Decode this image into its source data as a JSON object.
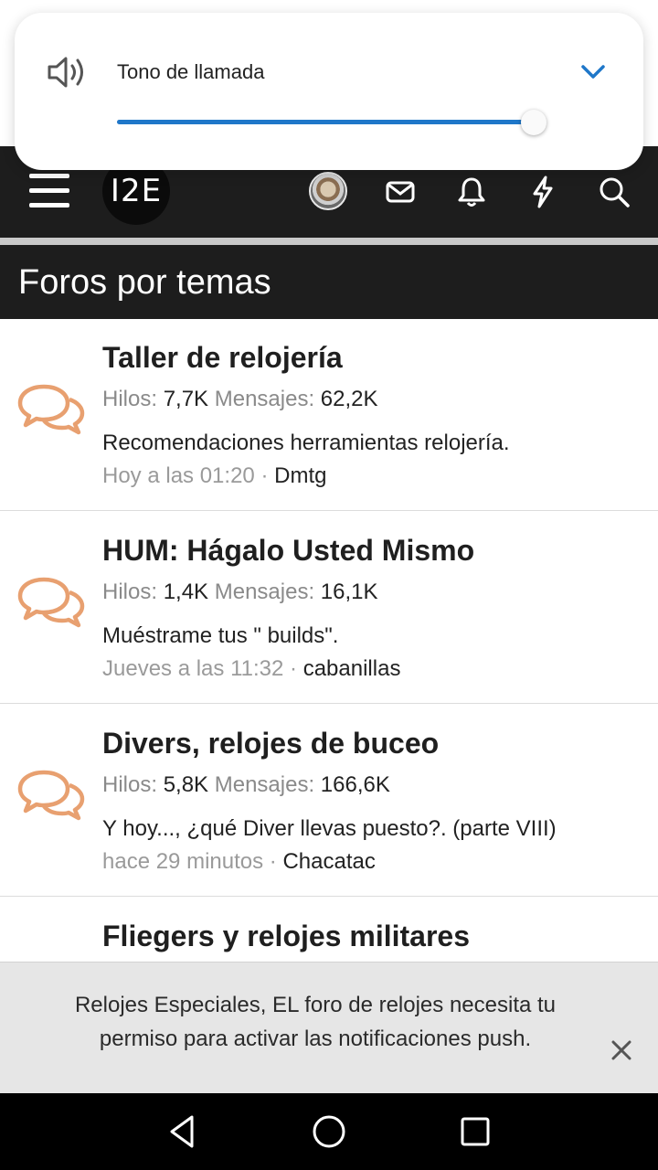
{
  "volume_panel": {
    "label": "Tono de llamada",
    "level": 0.97,
    "accent_color": "#1f77c9",
    "speaker_icon": "speaker-icon",
    "expand_icon": "chevron-down-icon"
  },
  "header": {
    "logo_text": "I2E",
    "icons": [
      "menu-icon",
      "avatar",
      "mail-icon",
      "bell-icon",
      "bolt-icon",
      "search-icon"
    ]
  },
  "section": {
    "title": "Foros por temas"
  },
  "forums": [
    {
      "title": "Taller de relojería",
      "threads_label": "Hilos:",
      "threads": "7,7K",
      "messages_label": "Mensajes:",
      "messages": "62,2K",
      "last_thread": "Recomendaciones herramientas relojería.",
      "last_time": "Hoy a las 01:20",
      "separator": "·",
      "last_user": "Dmtg"
    },
    {
      "title": "HUM: Hágalo Usted Mismo",
      "threads_label": "Hilos:",
      "threads": "1,4K",
      "messages_label": "Mensajes:",
      "messages": "16,1K",
      "last_thread": "Muéstrame tus \" builds\".",
      "last_time": "Jueves a las 11:32",
      "separator": "·",
      "last_user": "cabanillas"
    },
    {
      "title": "Divers, relojes de buceo",
      "threads_label": "Hilos:",
      "threads": "5,8K",
      "messages_label": "Mensajes:",
      "messages": "166,6K",
      "last_thread": "Y hoy..., ¿qué Diver llevas puesto?. (parte VIII)",
      "last_time": "hace 29 minutos",
      "separator": "·",
      "last_user": "Chacatac"
    },
    {
      "title": "Fliegers y relojes militares"
    }
  ],
  "push_banner": {
    "message": "Relojes Especiales, EL foro de relojes necesita tu permiso para activar las notificaciones push.",
    "close_icon": "close-icon"
  },
  "nav": {
    "icons": [
      "back-icon",
      "home-icon",
      "recents-icon"
    ]
  },
  "colors": {
    "header_bg": "#1d1d1d",
    "forum_icon": "#e8a070"
  }
}
